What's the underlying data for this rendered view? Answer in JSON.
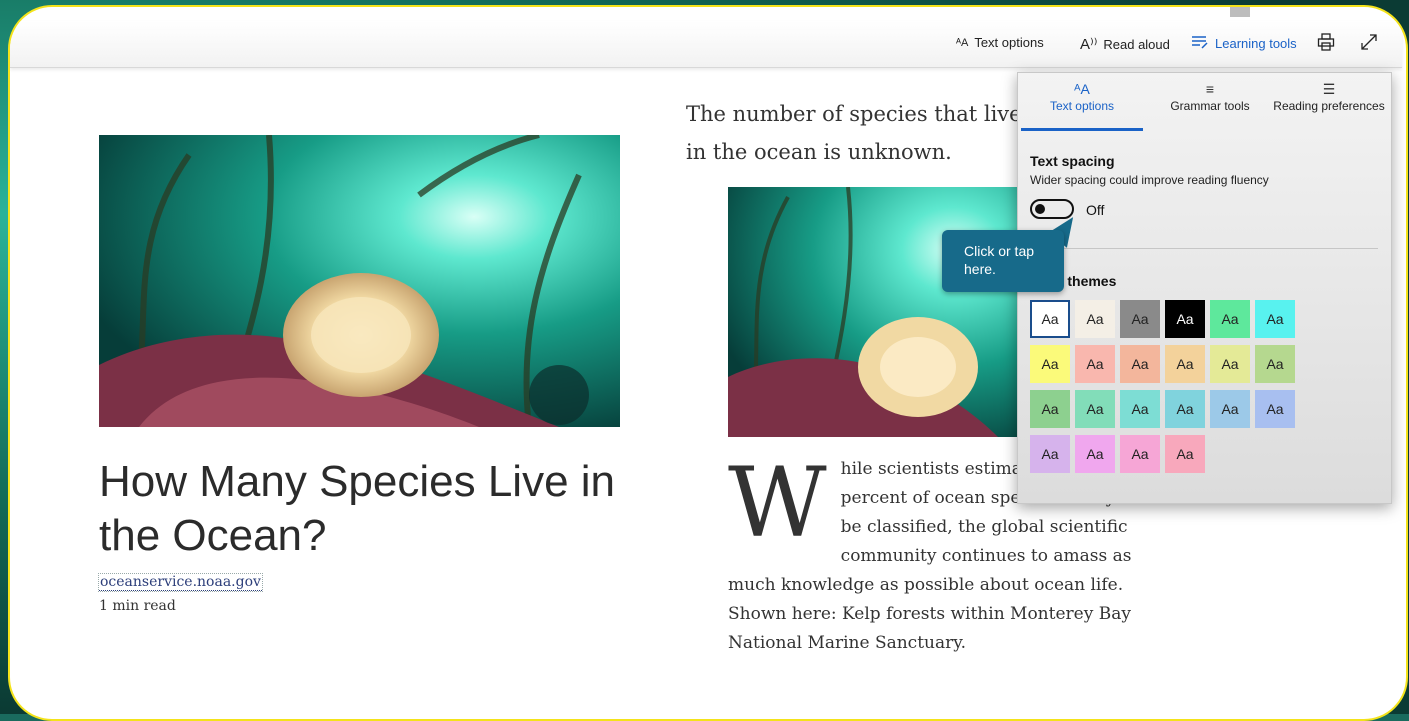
{
  "toolbar": {
    "text_options": "Text options",
    "read_aloud": "Read aloud",
    "learning_tools": "Learning tools",
    "icons": {
      "text_options": "text-options-icon",
      "read_aloud": "read-aloud-icon",
      "learning_tools": "learning-tools-icon",
      "print": "print-icon",
      "fullscreen": "fullscreen-icon"
    }
  },
  "article": {
    "title": "How Many Species Live in the Ocean?",
    "source": "oceanservice.noaa.gov",
    "read_time": "1 min read",
    "intro": "The number of species that live in the ocean is unknown.",
    "dropcap": "W",
    "body": "hile scientists estimate that some 91 percent of ocean species have yet to be classified, the global scientific community continues to amass as much knowledge as possible about ocean life. Shown here: Kelp forests within Monterey Bay National Marine Sanctuary."
  },
  "panel": {
    "tabs": [
      {
        "label": "Text options",
        "icon": "text-options-icon"
      },
      {
        "label": "Grammar tools",
        "icon": "grammar-tools-icon"
      },
      {
        "label": "Reading preferences",
        "icon": "reading-preferences-icon"
      }
    ],
    "text_spacing": {
      "title": "Text spacing",
      "description": "Wider spacing could improve reading fluency",
      "state": "Off"
    },
    "themes_title": "Page themes",
    "theme_label": "Aa",
    "themes": [
      {
        "bg": "#ffffff",
        "fg": "#222222"
      },
      {
        "bg": "#f4efe6",
        "fg": "#222222"
      },
      {
        "bg": "#8a8a8a",
        "fg": "#222222"
      },
      {
        "bg": "#000000",
        "fg": "#ffffff"
      },
      {
        "bg": "#5ee89c",
        "fg": "#222222"
      },
      {
        "bg": "#58f2ef",
        "fg": "#222222"
      },
      {
        "bg": "#fbfa7a",
        "fg": "#222222"
      },
      {
        "bg": "#f9b7ae",
        "fg": "#222222"
      },
      {
        "bg": "#f3b69c",
        "fg": "#222222"
      },
      {
        "bg": "#f3d29b",
        "fg": "#222222"
      },
      {
        "bg": "#e4ea97",
        "fg": "#222222"
      },
      {
        "bg": "#b5d88f",
        "fg": "#222222"
      },
      {
        "bg": "#8dd08f",
        "fg": "#222222"
      },
      {
        "bg": "#82ddb9",
        "fg": "#222222"
      },
      {
        "bg": "#7dddd4",
        "fg": "#222222"
      },
      {
        "bg": "#80d3dd",
        "fg": "#222222"
      },
      {
        "bg": "#9cc9e8",
        "fg": "#222222"
      },
      {
        "bg": "#a8bff0",
        "fg": "#222222"
      },
      {
        "bg": "#d6b3ec",
        "fg": "#222222"
      },
      {
        "bg": "#f0a7ee",
        "fg": "#222222"
      },
      {
        "bg": "#f6a6d6",
        "fg": "#222222"
      },
      {
        "bg": "#f8a8bc",
        "fg": "#222222"
      }
    ]
  },
  "tooltip": {
    "text": "Click or tap here."
  },
  "colors": {
    "accent": "#1a62c7",
    "tooltip": "#176a8a",
    "frame_border": "#f4e31a"
  }
}
